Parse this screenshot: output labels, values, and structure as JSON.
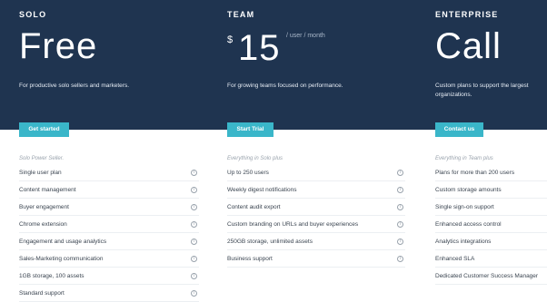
{
  "plans": [
    {
      "name": "SOLO",
      "price": "Free",
      "description": "For productive solo sellers and marketers.",
      "cta": "Get started",
      "subtitle": "Solo Power Seller.",
      "features": [
        "Single user plan",
        "Content management",
        "Buyer engagement",
        "Chrome extension",
        "Engagement and usage analytics",
        "Sales-Marketing communication",
        "1GB storage, 100 assets",
        "Standard support"
      ],
      "has_info_icons": true
    },
    {
      "name": "TEAM",
      "currency": "$",
      "price": "15",
      "per": "/ user / month",
      "description": "For growing teams focused on performance.",
      "cta": "Start Trial",
      "subtitle": "Everything in Solo plus",
      "features": [
        "Up to 250 users",
        "Weekly digest notifications",
        "Content audit export",
        "Custom branding on URLs and buyer experiences",
        "250GB storage, unlimited assets",
        "Business support"
      ],
      "has_info_icons": true
    },
    {
      "name": "ENTERPRISE",
      "price": "Call",
      "description": "Custom plans to support the largest organizations.",
      "cta": "Contact us",
      "subtitle": "Everything in Team plus",
      "features": [
        "Plans for more than 200 users",
        "Custom storage amounts",
        "Single sign-on support",
        "Enhanced access control",
        "Analytics integrations",
        "Enhanced SLA",
        "Dedicated Customer Success Manager"
      ],
      "has_info_icons": false
    }
  ],
  "info_icon_glyph": "i",
  "colors": {
    "hero_background": "#1f3450",
    "button": "#3ab6c9",
    "button_text": "#ffffff"
  }
}
